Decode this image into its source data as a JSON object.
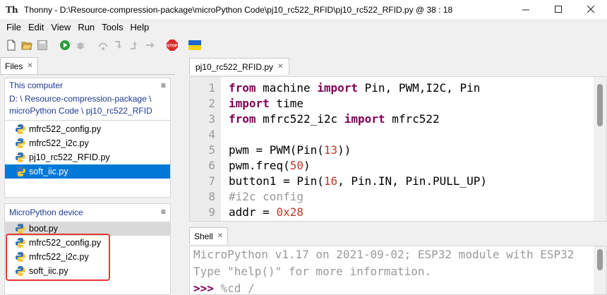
{
  "window": {
    "title": "Thonny  -  D:\\Resource-compression-package\\microPython Code\\pj10_rc522_RFID\\pj10_rc522_RFID.py  @  38 : 18",
    "app_glyph": "Th"
  },
  "menu": [
    "File",
    "Edit",
    "View",
    "Run",
    "Tools",
    "Help"
  ],
  "toolbar": {
    "icons": [
      "new-file-icon",
      "open-folder-icon",
      "save-icon",
      "run-icon",
      "debug-icon",
      "step-over-icon",
      "step-into-icon",
      "step-out-icon",
      "resume-icon",
      "stop-icon",
      "ukraine-flag-icon"
    ],
    "stop_label": "STOP"
  },
  "files_panel": {
    "tab_label": "Files",
    "this_computer": {
      "heading": "This computer",
      "path": [
        "D: \\ Resource-compression-package \\",
        "microPython Code \\ pj10_rc522_RFID"
      ],
      "files": [
        "mfrc522_config.py",
        "mfrc522_i2c.py",
        "pj10_rc522_RFID.py",
        "soft_iic.py"
      ],
      "selected": "soft_iic.py"
    },
    "device": {
      "heading": "MicroPython device",
      "files": [
        "boot.py",
        "mfrc522_config.py",
        "mfrc522_i2c.py",
        "soft_iic.py"
      ]
    }
  },
  "editor": {
    "tab_label": "pj10_rc522_RFID.py",
    "line_numbers": [
      "1",
      "2",
      "3",
      "4",
      "5",
      "6",
      "7",
      "8",
      "9"
    ],
    "lines": [
      [
        {
          "t": "kw",
          "v": "from"
        },
        {
          "t": "p",
          "v": " machine "
        },
        {
          "t": "kw",
          "v": "import"
        },
        {
          "t": "p",
          "v": " Pin, PWM,I2C, Pin"
        }
      ],
      [
        {
          "t": "kw",
          "v": "import"
        },
        {
          "t": "p",
          "v": " time"
        }
      ],
      [
        {
          "t": "kw",
          "v": "from"
        },
        {
          "t": "p",
          "v": " mfrc522_i2c "
        },
        {
          "t": "kw",
          "v": "import"
        },
        {
          "t": "p",
          "v": " mfrc522"
        }
      ],
      [],
      [
        {
          "t": "p",
          "v": "pwm = PWM(Pin("
        },
        {
          "t": "num",
          "v": "13"
        },
        {
          "t": "p",
          "v": "))"
        }
      ],
      [
        {
          "t": "p",
          "v": "pwm.freq("
        },
        {
          "t": "num",
          "v": "50"
        },
        {
          "t": "p",
          "v": ")"
        }
      ],
      [
        {
          "t": "p",
          "v": "button1 = Pin("
        },
        {
          "t": "num",
          "v": "16"
        },
        {
          "t": "p",
          "v": ", Pin.IN, Pin.PULL_UP)"
        }
      ],
      [
        {
          "t": "cmt",
          "v": "#i2c config"
        }
      ],
      [
        {
          "t": "p",
          "v": "addr = "
        },
        {
          "t": "num",
          "v": "0x28"
        }
      ]
    ]
  },
  "shell": {
    "tab_label": "Shell",
    "lines": [
      "MicroPython v1.17 on 2021-09-02; ESP32 module with ESP32",
      "Type \"help()\" for more information."
    ],
    "prompt": ">>>",
    "command": " %cd /"
  },
  "colors": {
    "selection": "#0078d7",
    "highlight_box": "#e53935",
    "keyword": "#7f0055",
    "number": "#c0392b"
  }
}
